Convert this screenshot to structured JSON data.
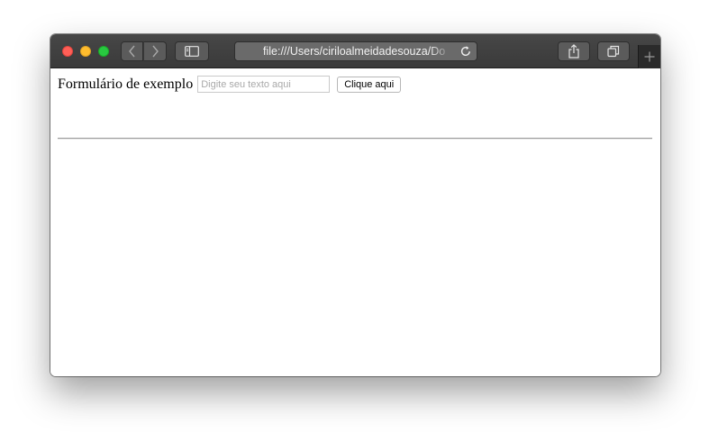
{
  "browser": {
    "address": "file:///Users/ciriloalmeidadesouza/Do",
    "icons": {
      "back": "chevron-left-icon",
      "forward": "chevron-right-icon",
      "sidebar": "sidebar-icon",
      "reload": "reload-icon",
      "share": "share-icon",
      "tabs": "tabs-overview-icon",
      "new_tab": "plus-icon"
    },
    "colors": {
      "close": "#ff5f57",
      "minimize": "#febc2e",
      "maximize": "#28c840",
      "toolbar": "#3f3f3f"
    }
  },
  "page": {
    "form_title": "Formulário de exemplo",
    "input": {
      "value": "",
      "placeholder": "Digite seu texto aqui"
    },
    "button_label": "Clique aqui"
  }
}
